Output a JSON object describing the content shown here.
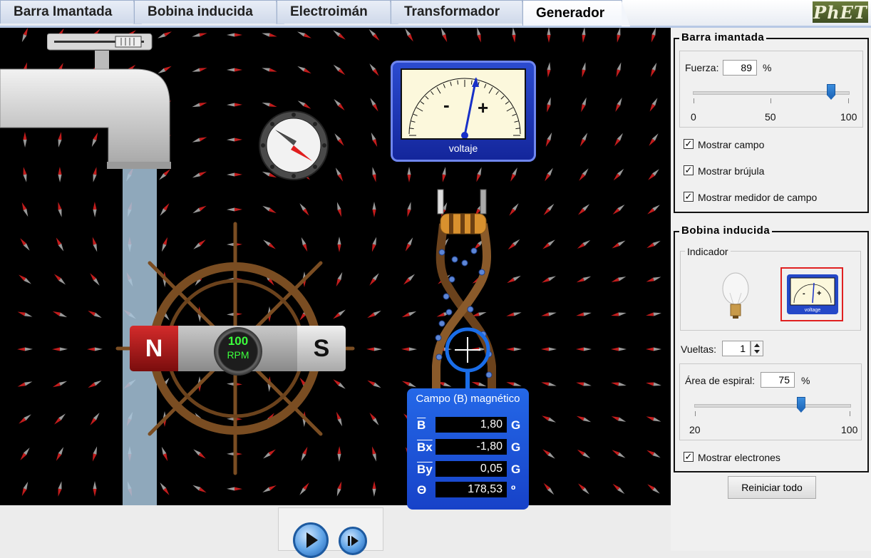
{
  "tabs": [
    {
      "label": "Barra Imantada"
    },
    {
      "label": "Bobina inducida"
    },
    {
      "label": "Electroimán"
    },
    {
      "label": "Transformador"
    },
    {
      "label": "Generador"
    }
  ],
  "active_tab": "Generador",
  "logo": "PhET",
  "canvas": {
    "rpm_value": "100",
    "rpm_unit": "RPM",
    "magnet_north": "N",
    "magnet_south": "S",
    "voltmeter": {
      "minus": "-",
      "plus": "+",
      "label": "voltaje"
    },
    "field_meter": {
      "title": "Campo (B) magnético",
      "rows": [
        {
          "name": "B",
          "value": "1,80",
          "unit": "G"
        },
        {
          "name": "Bx",
          "value": "-1,80",
          "unit": "G"
        },
        {
          "name": "By",
          "value": "0,05",
          "unit": "G"
        },
        {
          "name": "Θ",
          "value": "178,53",
          "unit": "º"
        }
      ]
    }
  },
  "bar_magnet_panel": {
    "title": "Barra imantada",
    "strength_label": "Fuerza:",
    "strength_value": "89",
    "strength_unit": "%",
    "slider": {
      "min": "0",
      "mid": "50",
      "max": "100",
      "value": 89
    },
    "checkboxes": [
      {
        "label": "Mostrar campo",
        "checked": true
      },
      {
        "label": "Mostrar brújula",
        "checked": true
      },
      {
        "label": "Mostrar medidor de campo",
        "checked": true
      }
    ]
  },
  "pickup_coil_panel": {
    "title": "Bobina inducida",
    "indicator_label": "Indicador",
    "indicator_options": [
      "lightbulb-icon",
      "voltmeter-icon"
    ],
    "selected_indicator": "voltmeter-icon",
    "mini_voltmeter_label": "voltage",
    "loops_label": "Vueltas:",
    "loops_value": "1",
    "area_label": "Área de espiral:",
    "area_value": "75",
    "area_unit": "%",
    "area_slider": {
      "min": "20",
      "max": "100",
      "value": 75
    },
    "show_electrons_label": "Mostrar electrones",
    "show_electrons_checked": true
  },
  "reset_button": "Reiniciar todo",
  "check_mark": "✓",
  "colors": {
    "accent": "#1c62b5",
    "canvas_bg": "#000000",
    "meter_bg": "#2458e0",
    "highlight": "#e02020"
  }
}
